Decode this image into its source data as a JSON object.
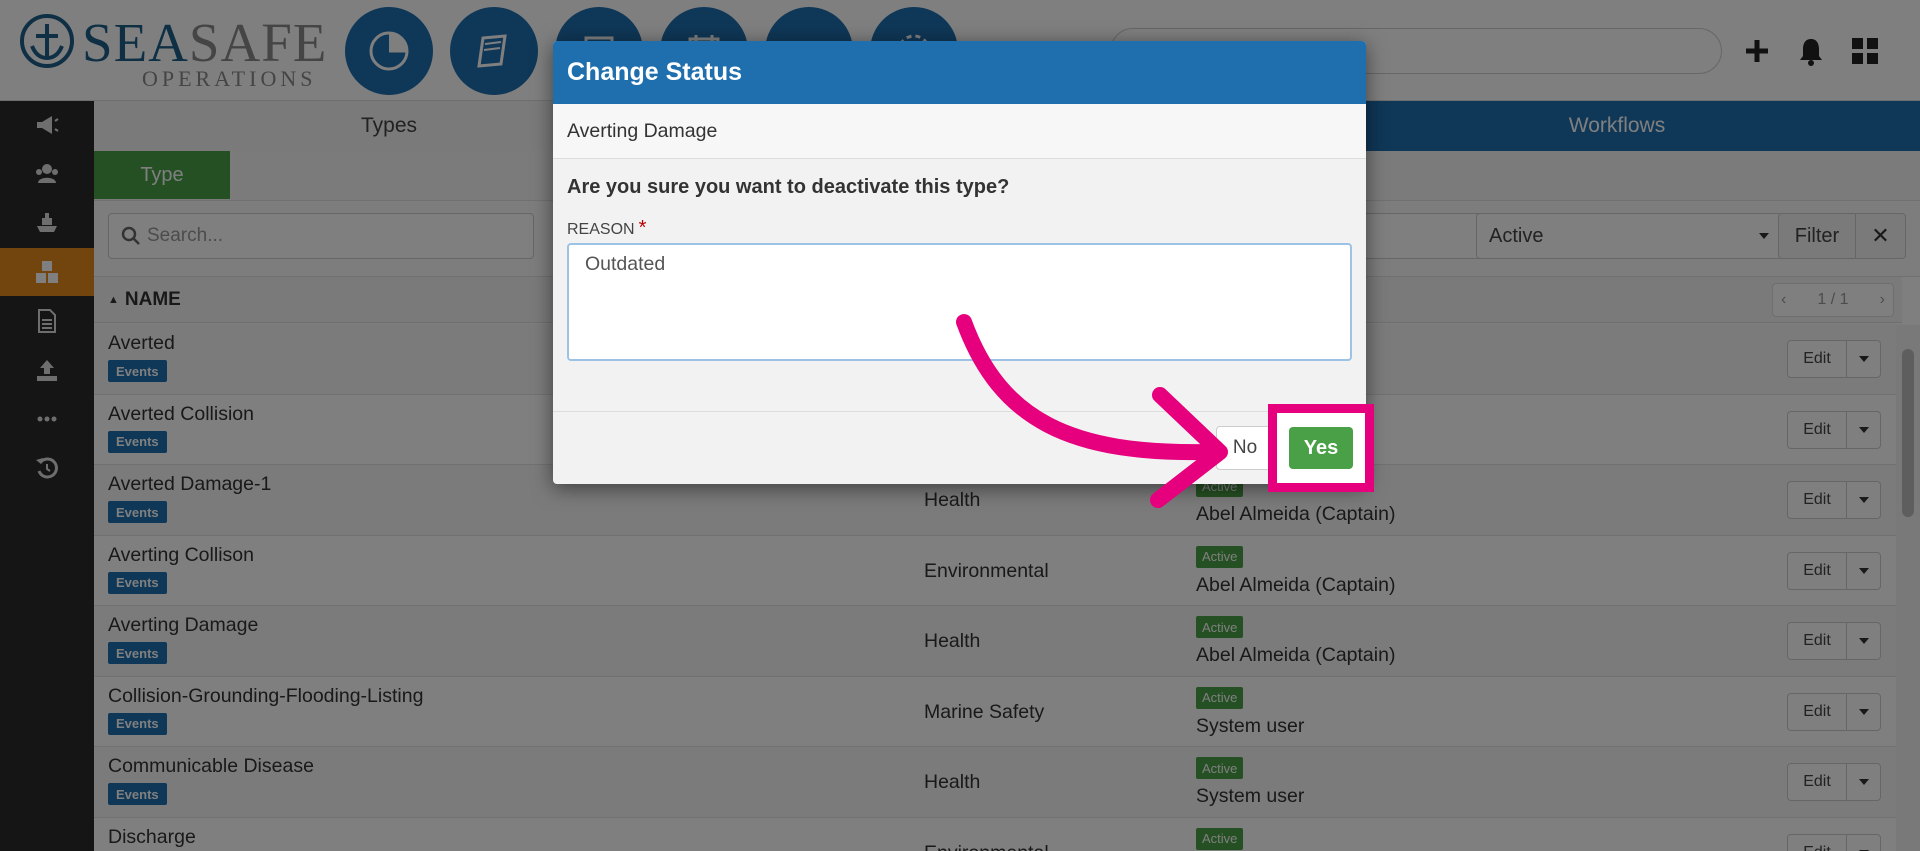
{
  "brand": {
    "name_part1": "SEA",
    "name_part2": "SAFE",
    "tagline": "OPERATIONS"
  },
  "header": {
    "nav_icons": [
      "dashboard-pie-icon",
      "logbook-icon",
      "list-icon",
      "calendar-icon",
      "chart-icon",
      "gear-icon"
    ],
    "actions": [
      "plus-icon",
      "bell-icon",
      "grid-icon"
    ]
  },
  "sidebar": {
    "items": [
      "megaphone-icon",
      "users-icon",
      "ship-icon",
      "cubes-icon",
      "document-icon",
      "upload-icon",
      "more-icon",
      "history-icon"
    ],
    "active_index": 3
  },
  "tabs": {
    "types": "Types",
    "workflows": "Workflows"
  },
  "subbar": {
    "type_button": "Type"
  },
  "filters": {
    "search_placeholder": "Search...",
    "status_value": "Active",
    "filter_label": "Filter",
    "clear_label": "✕"
  },
  "table": {
    "name_header": "NAME",
    "pager": "1 / 1",
    "rows": [
      {
        "name": "Averted",
        "tag": "Events",
        "category": "",
        "status": "",
        "user": "ain)"
      },
      {
        "name": "Averted Collision",
        "tag": "Events",
        "category": "",
        "status": "",
        "user": "ain)"
      },
      {
        "name": "Averted Damage-1",
        "tag": "Events",
        "category": "Health",
        "status": "Active",
        "user": "Abel Almeida (Captain)"
      },
      {
        "name": "Averting Collison",
        "tag": "Events",
        "category": "Environmental",
        "status": "Active",
        "user": "Abel Almeida (Captain)"
      },
      {
        "name": "Averting Damage",
        "tag": "Events",
        "category": "Health",
        "status": "Active",
        "user": "Abel Almeida (Captain)"
      },
      {
        "name": "Collision-Grounding-Flooding-Listing",
        "tag": "Events",
        "category": "Marine Safety",
        "status": "Active",
        "user": "System user"
      },
      {
        "name": "Communicable Disease",
        "tag": "Events",
        "category": "Health",
        "status": "Active",
        "user": "System user"
      },
      {
        "name": "Discharge",
        "tag": "",
        "category": "Environmental",
        "status": "Active",
        "user": ""
      }
    ],
    "edit_label": "Edit"
  },
  "modal": {
    "title": "Change Status",
    "subtitle": "Averting Damage",
    "question": "Are you sure you want to deactivate this type?",
    "reason_label": "REASON",
    "reason_required_mark": "*",
    "reason_value": "Outdated",
    "no_label": "No",
    "yes_label": "Yes"
  },
  "colors": {
    "primary": "#1f6fae",
    "success": "#4aa046",
    "accent": "#e68a1c",
    "highlight": "#e6007e"
  }
}
